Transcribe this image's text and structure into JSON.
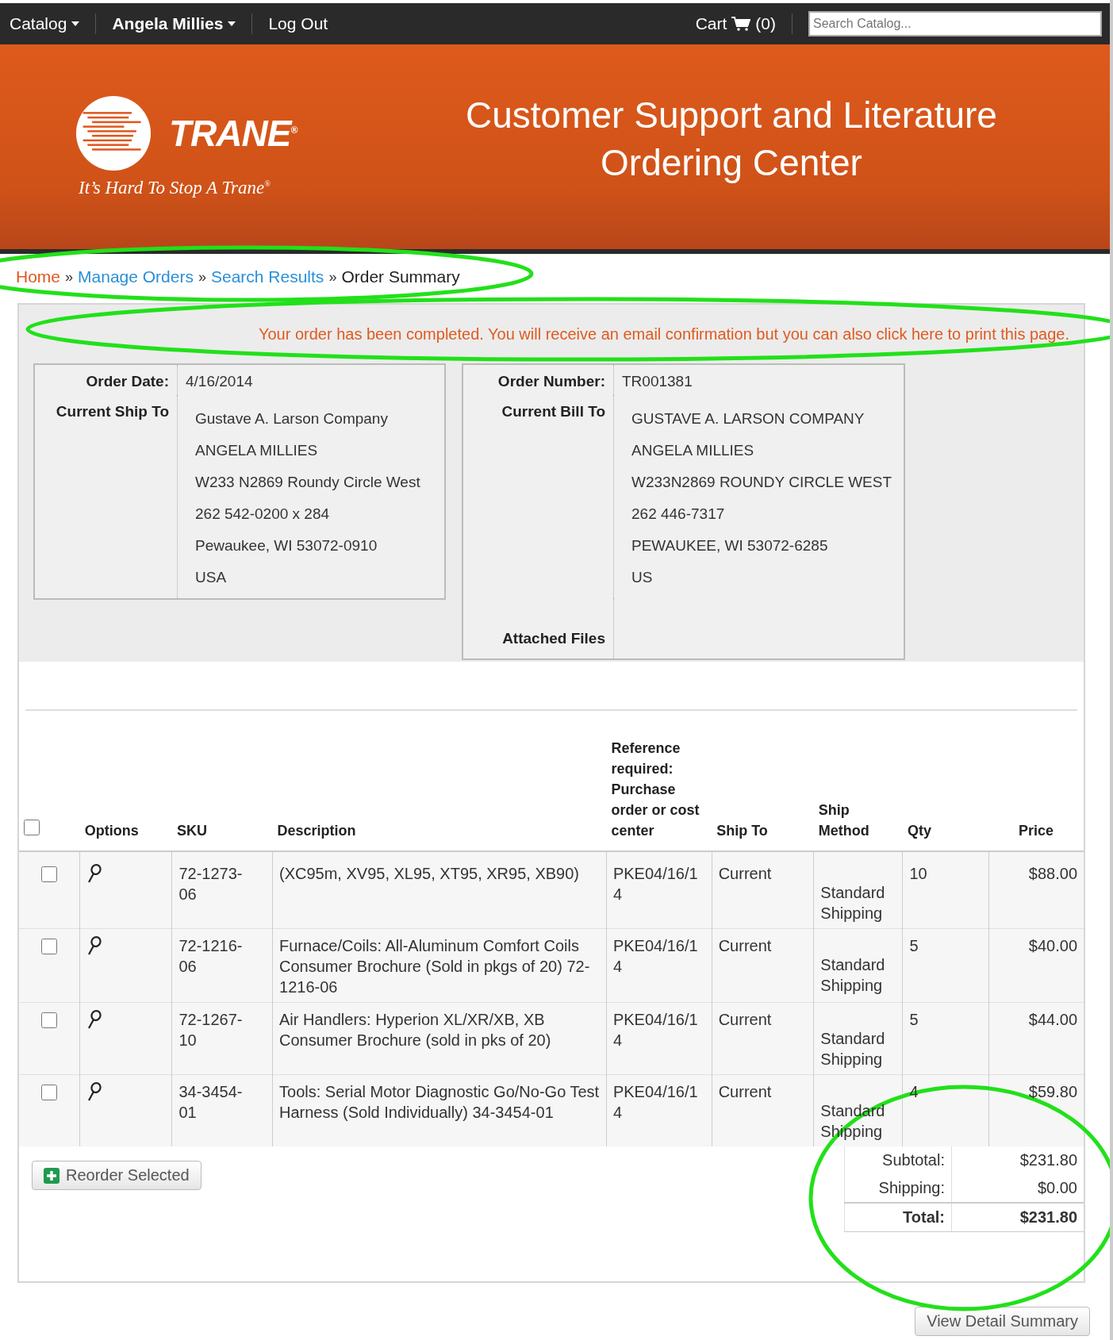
{
  "top_bar": {
    "menus": [
      {
        "label": "Catalog",
        "kind": "dropdown",
        "bold": false
      },
      {
        "label": "Angela Millies",
        "kind": "dropdown",
        "bold": true
      },
      {
        "label": "Log Out",
        "kind": "link",
        "bold": false
      }
    ],
    "cart": {
      "label": "Cart",
      "count": "(0)"
    },
    "search": {
      "placeholder": "Search Catalog..."
    }
  },
  "banner": {
    "logo_text": "TRANE$^{®}$",
    "tagline": "It’s Hard To Stop A Trane$^{®}$",
    "title": "Customer Support and Literature Ordering Center"
  },
  "breadcrumb": [
    {
      "label": "Home",
      "kind": "home"
    },
    {
      "prefix": "»",
      "label": "Manage Orders",
      "kind": "link"
    },
    {
      "prefix": "»",
      "label": "Search Results",
      "kind": "link"
    },
    {
      "prefix": "»",
      "label": "Order Summary",
      "kind": "current"
    }
  ],
  "message": "Your order has been completed. You will receive an email confirmation but you can also click here to print this page.",
  "order_info": [
    {
      "field_label": "Order Date:",
      "field_value": "4/16/2014",
      "address_label": "Current Ship To",
      "address_lines": [
        "Gustave A. Larson Company",
        "ANGELA MILLIES",
        "W233 N2869 Roundy Circle West",
        "262 542-0200 x 284",
        "Pewaukee, WI 53072-0910",
        "USA"
      ]
    },
    {
      "field_label": "Order Number:",
      "field_value": "TR001381",
      "address_label": "Current Bill To",
      "address_lines": [
        "GUSTAVE A. LARSON COMPANY",
        "ANGELA MILLIES",
        "W233N2869 ROUNDY CIRCLE WEST",
        "262 446-7317",
        "PEWAUKEE, WI 53072-6285",
        "US"
      ],
      "attached_files_label": "Attached Files"
    }
  ],
  "table": {
    "select_all": {
      "checked": false
    },
    "columns": [
      "Options",
      "SKU",
      "Description",
      "Reference required: Purchase order or cost center",
      "Ship To",
      "Ship Method",
      "Qty",
      "Price"
    ],
    "rows": [
      {
        "checked": false,
        "sku": "72-1273-06",
        "description": "(XC95m, XV95, XL95, XT95, XR95, XB90)",
        "reference": "PKE04/16/14",
        "ship_to": "Current",
        "ship_method": "Standard Shipping",
        "qty": "10",
        "price": "$88.00"
      },
      {
        "checked": false,
        "sku": "72-1216-06",
        "description": "Furnace/Coils: All-Aluminum Comfort Coils Consumer Brochure (Sold in pkgs of 20) 72-1216-06",
        "reference": "PKE04/16/14",
        "ship_to": "Current",
        "ship_method": "Standard Shipping",
        "qty": "5",
        "price": "$40.00"
      },
      {
        "checked": false,
        "sku": "72-1267-10",
        "description": "Air Handlers: Hyperion XL/XR/XB, XB Consumer Brochure (sold in pks of 20)",
        "reference": "PKE04/16/14",
        "ship_to": "Current",
        "ship_method": "Standard Shipping",
        "qty": "5",
        "price": "$44.00"
      },
      {
        "checked": false,
        "sku": "34-3454-01",
        "description": "Tools: Serial Motor Diagnostic Go/No-Go Test Harness (Sold Individually) 34-3454-01",
        "reference": "PKE04/16/14",
        "ship_to": "Current",
        "ship_method": "Standard Shipping",
        "qty": "4",
        "price": "$59.80"
      }
    ]
  },
  "reorder_button": "Reorder Selected",
  "totals": [
    {
      "label": "Subtotal:",
      "value": "$231.80",
      "kind": "line"
    },
    {
      "label": "Shipping:",
      "value": "$0.00",
      "kind": "line"
    },
    {
      "label": "Total:",
      "value": "$231.80",
      "kind": "total"
    }
  ],
  "detail_button": "View Detail Summary"
}
